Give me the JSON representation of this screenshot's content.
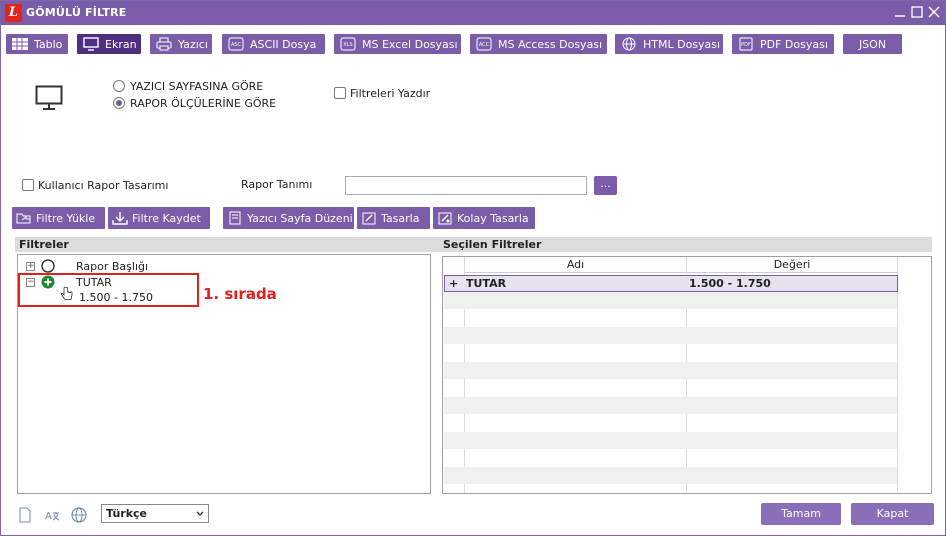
{
  "window": {
    "title": "GÖMÜLÜ FİLTRE",
    "logo_letter": "L"
  },
  "toolbar": {
    "tablo": "Tablo",
    "ekran": "Ekran",
    "yazici": "Yazıcı",
    "ascii": "ASCII Dosya",
    "excel": "MS Excel Dosyası",
    "access": "MS Access Dosyası",
    "html": "HTML Dosyası",
    "pdf": "PDF Dosyası",
    "json": "JSON"
  },
  "output_options": {
    "yazici_sayfasina_gore": "YAZICI SAYFASINA GÖRE",
    "rapor_olculerine_gore": "RAPOR ÖLÇÜLERİNE GÖRE",
    "selected": "rapor_olculerine_gore",
    "filtreleri_yazdir": "Filtreleri Yazdır"
  },
  "report": {
    "kullanici_rapor_tasarimi": "Kullanıcı Rapor Tasarımı",
    "rapor_tanimi_label": "Rapor Tanımı",
    "rapor_tanimi_value": "",
    "browse_label": "..."
  },
  "actions": {
    "filtre_yukle": "Filtre Yükle",
    "filtre_kaydet": "Filtre Kaydet",
    "yazici_sayfa_duzeni": "Yazıcı Sayfa Düzeni",
    "tasarla": "Tasarla",
    "kolay_tasarla": "Kolay Tasarla"
  },
  "filters_panel": {
    "header": "Filtreler",
    "items": [
      {
        "label": "Rapor Başlığı",
        "expander": "+"
      },
      {
        "label": "TUTAR",
        "expander": "−",
        "value": "1.500 - 1.750"
      }
    ],
    "annotation": "1. sırada"
  },
  "selected_filters": {
    "header": "Seçilen Filtreler",
    "columns": [
      "Adı",
      "Değeri"
    ],
    "rows": [
      {
        "marker": "+",
        "name": "TUTAR",
        "value": "1.500 - 1.750"
      }
    ]
  },
  "footer": {
    "language": "Türkçe",
    "ok": "Tamam",
    "close": "Kapat"
  },
  "colors": {
    "accent": "#7a5ca8",
    "active": "#4e2f82",
    "annotation": "#e02020",
    "logo": "#e1251b"
  }
}
